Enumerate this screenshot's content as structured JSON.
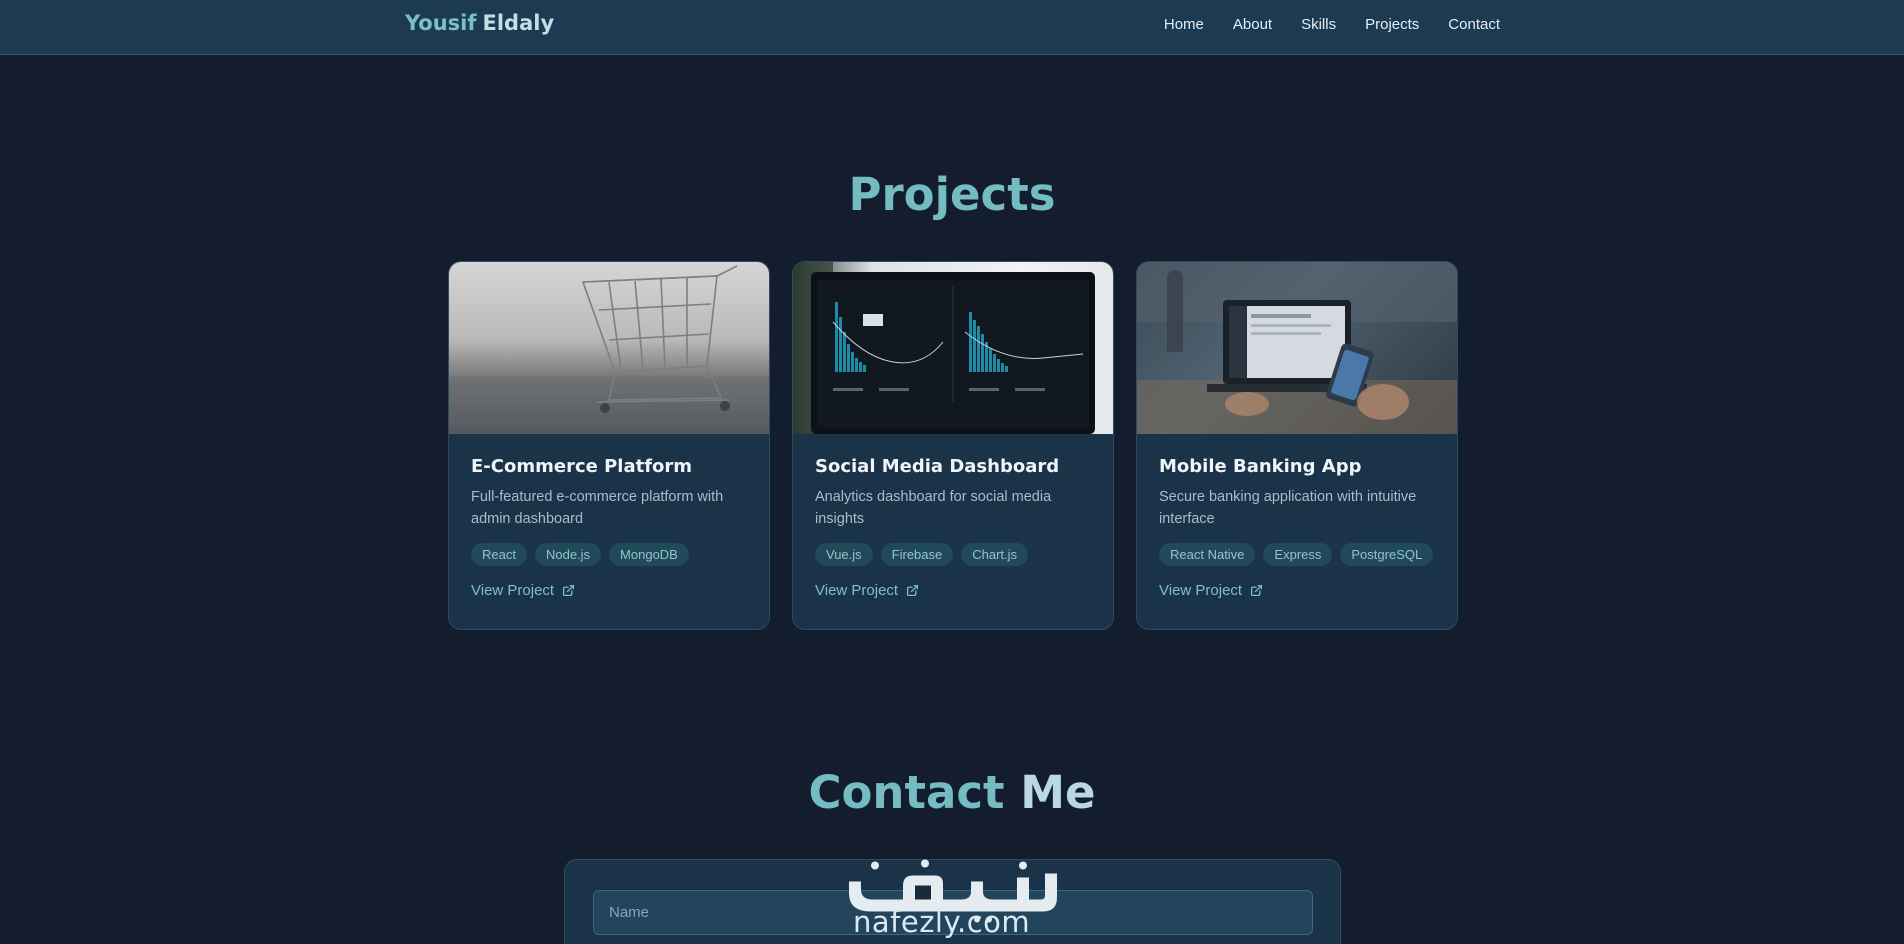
{
  "nav": {
    "logo_first": "Yousif",
    "logo_last": "Eldaly",
    "links": [
      "Home",
      "About",
      "Skills",
      "Projects",
      "Contact"
    ]
  },
  "projects": {
    "title_a": "Projects",
    "cards": [
      {
        "title": "E-Commerce Platform",
        "description": "Full-featured e-commerce platform with admin dashboard",
        "tags": [
          "React",
          "Node.js",
          "MongoDB"
        ],
        "link_label": "View Project",
        "image": "shopping-cart-photo"
      },
      {
        "title": "Social Media Dashboard",
        "description": "Analytics dashboard for social media insights",
        "tags": [
          "Vue.js",
          "Firebase",
          "Chart.js"
        ],
        "link_label": "View Project",
        "image": "analytics-dashboard-photo"
      },
      {
        "title": "Mobile Banking App",
        "description": "Secure banking application with intuitive interface",
        "tags": [
          "React Native",
          "Express",
          "PostgreSQL"
        ],
        "link_label": "View Project",
        "image": "laptop-phone-photo"
      }
    ]
  },
  "contact": {
    "title_a": "Contact",
    "title_b": "Me",
    "name_placeholder": "Name"
  },
  "watermark": {
    "arabic": "نفذلي",
    "latin": "nafezly.com"
  },
  "colors": {
    "background": "#131d2e",
    "navbar": "#1c3a52",
    "accent": "#7cc0c4",
    "card": "#1b3349"
  }
}
